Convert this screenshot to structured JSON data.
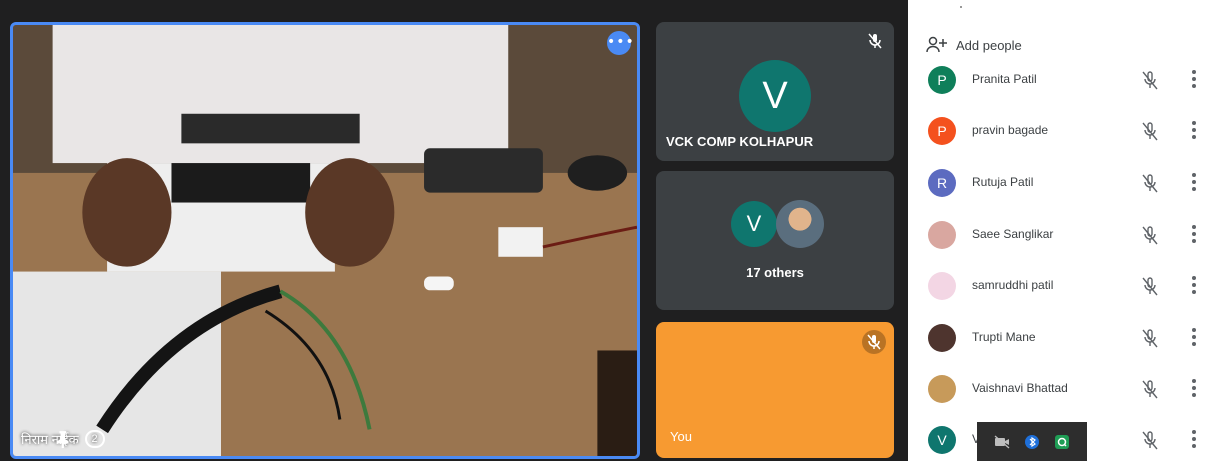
{
  "main_video": {
    "participant_name": "निराम नाईक",
    "badge_count": "2",
    "icons": [
      "more-options-icon",
      "pin-icon"
    ]
  },
  "tiles": [
    {
      "avatar_letter": "V",
      "name": "VCK COMP KOLHAPUR",
      "icon": "mic-off-icon",
      "avatar_color": "#0f766e"
    },
    {
      "avatar_letter": "V",
      "others_label": "17 others",
      "avatar_color": "#0f766e"
    },
    {
      "name": "You",
      "background": "#f79a31",
      "icon": "mic-off-icon"
    }
  ],
  "panel": {
    "add_people_label": "Add people",
    "participants": [
      {
        "name": "Pranita Patil",
        "initial": "P",
        "color": "#0f7f5a"
      },
      {
        "name": "pravin bagade",
        "initial": "P",
        "color": "#f4511e"
      },
      {
        "name": "Rutuja Patil",
        "initial": "R",
        "color": "#5c6bc0"
      },
      {
        "name": "Saee Sanglikar",
        "initial": "",
        "color": "#d9a7a0"
      },
      {
        "name": "samruddhi patil",
        "initial": "",
        "color": "#f3d6e4"
      },
      {
        "name": "Trupti Mane",
        "initial": "",
        "color": "#4e342e"
      },
      {
        "name": "Vaishnavi Bhattad",
        "initial": "",
        "color": "#c79a5a"
      },
      {
        "name": "V",
        "initial": "V",
        "color": "#0f766e"
      }
    ]
  },
  "tray": {
    "icons": [
      "camera-off-icon",
      "bluetooth-icon",
      "app-icon-q"
    ]
  },
  "accent_color": "#4a8af4"
}
